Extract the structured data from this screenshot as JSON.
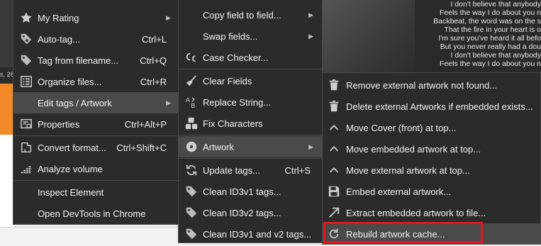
{
  "background": {
    "left_fragment": "s, 28",
    "lyrics": [
      "I don't believe that anybody",
      "Feels the way I do about you n",
      "Backbeat, the word was on the s",
      "That the fire in your heart is o",
      "I'm sure you've heard it all befo",
      "But you never really had a dou",
      "I don't believe that anybody",
      "Feels the way I do about you n"
    ]
  },
  "menu1": {
    "items": [
      {
        "label": "My Rating",
        "shortcut": "",
        "icon": "star-icon",
        "submenu": true
      },
      {
        "label": "Auto-tag...",
        "shortcut": "Ctrl+L",
        "icon": "auto-tag-icon",
        "submenu": false
      },
      {
        "label": "Tag from filename...",
        "shortcut": "Ctrl+Q",
        "icon": "tag-icon",
        "submenu": false
      },
      {
        "label": "Organize files...",
        "shortcut": "Ctrl+R",
        "icon": "organize-icon",
        "submenu": false
      },
      {
        "label": "Edit tags / Artwork",
        "shortcut": "",
        "icon": "",
        "submenu": true
      },
      {
        "label": "Properties",
        "shortcut": "Ctrl+Alt+P",
        "icon": "properties-icon",
        "submenu": false
      },
      {
        "label": "Convert format...",
        "shortcut": "Ctrl+Shift+C",
        "icon": "convert-icon",
        "submenu": false
      },
      {
        "label": "Analyze volume",
        "shortcut": "",
        "icon": "analyze-volume-icon",
        "submenu": false
      },
      {
        "label": "Inspect Element",
        "shortcut": "",
        "icon": "",
        "submenu": false
      },
      {
        "label": "Open DevTools in Chrome",
        "shortcut": "",
        "icon": "",
        "submenu": false
      }
    ]
  },
  "menu2": {
    "items": [
      {
        "label": "Copy field to field...",
        "shortcut": "",
        "submenu": true,
        "icon": ""
      },
      {
        "label": "Swap fields...",
        "shortcut": "",
        "submenu": true,
        "icon": ""
      },
      {
        "label": "Case Checker...",
        "shortcut": "",
        "submenu": false,
        "icon": "case-checker-icon"
      },
      {
        "label": "Clear Fields",
        "shortcut": "",
        "submenu": false,
        "icon": "broom-icon"
      },
      {
        "label": "Replace String...",
        "shortcut": "",
        "submenu": false,
        "icon": "replace-string-icon"
      },
      {
        "label": "Fix Characters",
        "shortcut": "",
        "submenu": false,
        "icon": "fix-characters-icon"
      },
      {
        "label": "Artwork",
        "shortcut": "",
        "submenu": true,
        "icon": "disc-icon"
      },
      {
        "label": "Update tags...",
        "shortcut": "Ctrl+S",
        "submenu": false,
        "icon": "refresh-icon"
      },
      {
        "label": "Clean ID3v1 tags...",
        "shortcut": "",
        "submenu": false,
        "icon": "tag-icon"
      },
      {
        "label": "Clean ID3v2 tags...",
        "shortcut": "",
        "submenu": false,
        "icon": "tag-icon"
      },
      {
        "label": "Clean ID3v1 and v2 tags...",
        "shortcut": "",
        "submenu": false,
        "icon": "tag-icon"
      }
    ]
  },
  "menu3": {
    "items": [
      {
        "label": "Remove external artwork not found...",
        "icon": "trash-icon"
      },
      {
        "label": "Delete external Artworks if embedded exists...",
        "icon": "trash-icon"
      },
      {
        "label": "Move Cover (front) at top...",
        "icon": "chevron-up-icon"
      },
      {
        "label": "Move embedded artwork at top...",
        "icon": "chevron-up-icon"
      },
      {
        "label": "Move external artwork at top...",
        "icon": "chevron-up-icon"
      },
      {
        "label": "Embed external artwork...",
        "icon": "save-icon"
      },
      {
        "label": "Extract embedded artwork to file...",
        "icon": "arrow-up-right-icon"
      },
      {
        "label": "Rebuild artwork cache...",
        "icon": "refresh-icon"
      }
    ]
  },
  "colors": {
    "menu_bg": "#2b2b2b",
    "hover_bg": "#4a4a4a",
    "highlight_border": "#e3161f",
    "accent_orange": "#f28b27"
  }
}
